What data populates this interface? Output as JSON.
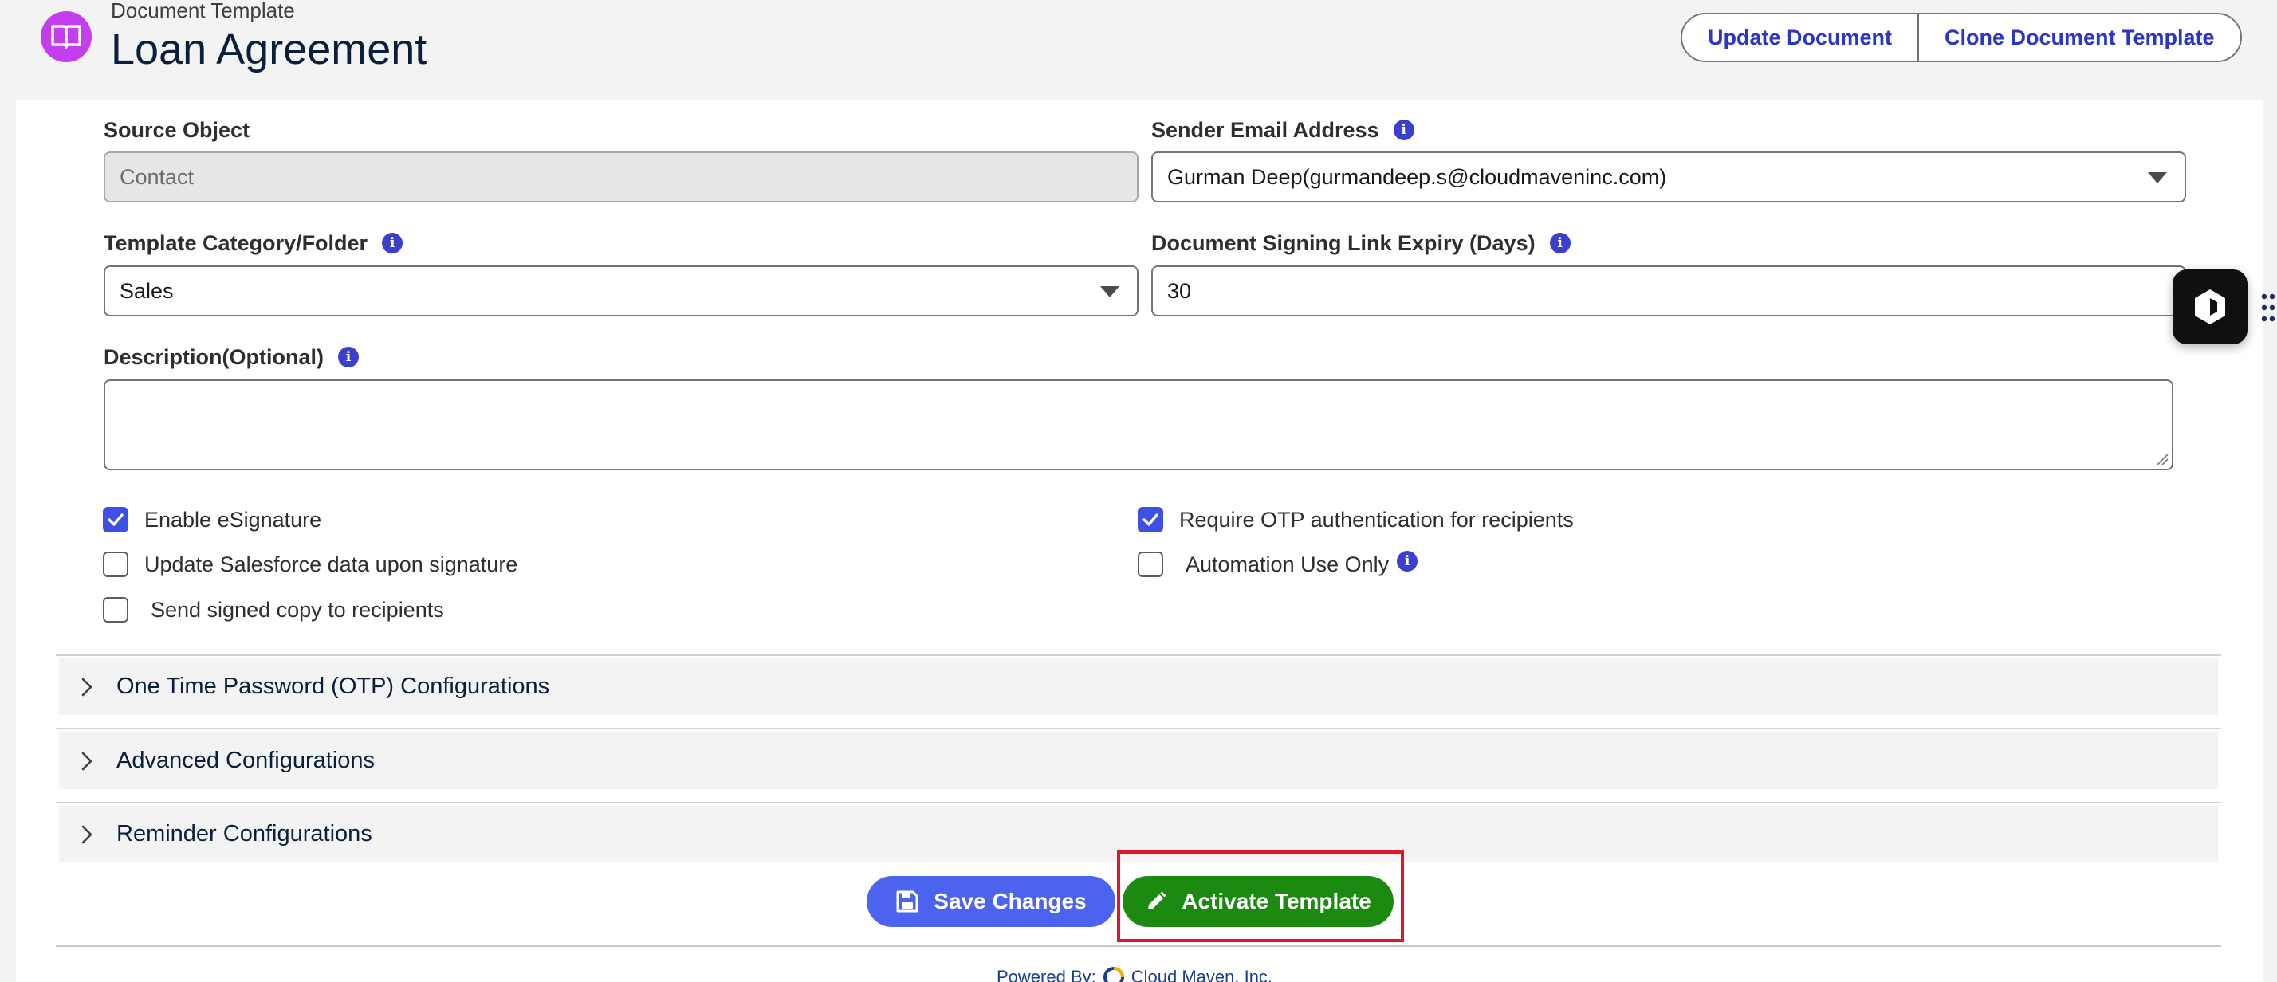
{
  "header": {
    "eyebrow": "Document Template",
    "title": "Loan Agreement",
    "actions": {
      "update_document": "Update Document",
      "clone_template": "Clone Document Template"
    }
  },
  "form": {
    "source_object": {
      "label": "Source Object",
      "value": "Contact"
    },
    "sender_email": {
      "label": "Sender Email Address",
      "value": "Gurman Deep(gurmandeep.s@cloudmaveninc.com)"
    },
    "template_category": {
      "label": "Template Category/Folder",
      "value": "Sales"
    },
    "signing_link_expiry": {
      "label": "Document Signing Link Expiry (Days)",
      "value": "30"
    },
    "description": {
      "label": "Description(Optional)",
      "value": ""
    }
  },
  "checkboxes": {
    "enable_esignature": {
      "label": "Enable eSignature",
      "checked": true
    },
    "update_salesforce": {
      "label": "Update Salesforce data upon signature",
      "checked": false
    },
    "send_signed_copy": {
      "label": "Send signed copy to recipients",
      "checked": false
    },
    "require_otp": {
      "label": "Require OTP authentication for recipients",
      "checked": true
    },
    "automation_only": {
      "label": "Automation Use Only",
      "checked": false
    }
  },
  "accordions": [
    {
      "label": "One Time Password (OTP) Configurations"
    },
    {
      "label": "Advanced Configurations"
    },
    {
      "label": "Reminder Configurations"
    }
  ],
  "buttons": {
    "save": "Save Changes",
    "activate": "Activate Template"
  },
  "footer": {
    "powered_by": "Powered By:",
    "company": "Cloud Maven, Inc."
  },
  "colors": {
    "primary_blue": "#4b63ee",
    "activate_green": "#1c8a10",
    "highlight_red": "#e0142a",
    "app_icon_purple": "#c43ef0"
  }
}
